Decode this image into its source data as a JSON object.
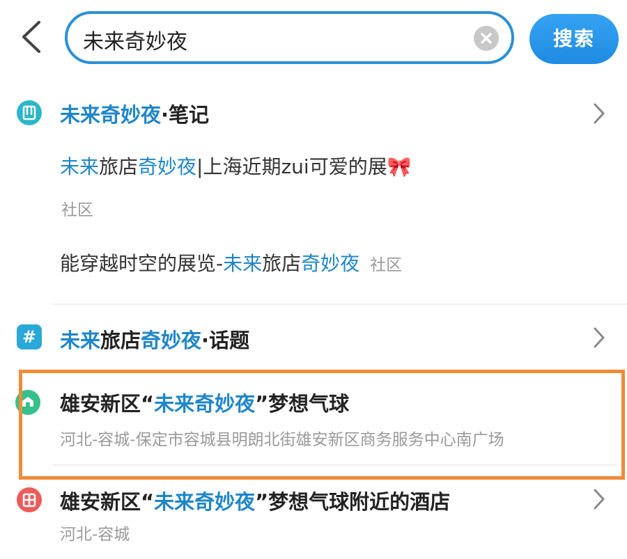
{
  "search": {
    "query": "未来奇妙夜",
    "button_label": "搜索"
  },
  "notes_section": {
    "title_hl": "未来奇妙夜",
    "title_rest": "·笔记",
    "items": [
      {
        "parts": [
          "未来",
          "旅店",
          "奇妙夜",
          "|上海近期zui可爱的展🎀"
        ],
        "source": "社区"
      },
      {
        "parts": [
          "能穿越时空的展览-",
          "未来",
          "旅店",
          "奇妙夜"
        ],
        "source": "社区"
      }
    ]
  },
  "topic_section": {
    "title_parts": [
      "未来",
      "旅店",
      "奇妙夜",
      "·话题"
    ]
  },
  "poi_result": {
    "title_parts": [
      "雄安新区“",
      "未来奇妙夜",
      "”梦想气球"
    ],
    "address": "河北-容城-保定市容城县明朗北街雄安新区商务服务中心南广场"
  },
  "hotel_result": {
    "title_parts": [
      "雄安新区“",
      "未来奇妙夜",
      "”梦想气球附近的酒店"
    ],
    "address": "河北-容城"
  },
  "colors": {
    "accent_blue": "#1f86c9",
    "search_border": "#2b8fd8",
    "highlight_frame": "#ef8c38",
    "note_icon": "#2bb6c9",
    "topic_icon": "#2aa9d8",
    "poi_icon": "#35c08c",
    "hotel_icon": "#ef5b5b"
  }
}
